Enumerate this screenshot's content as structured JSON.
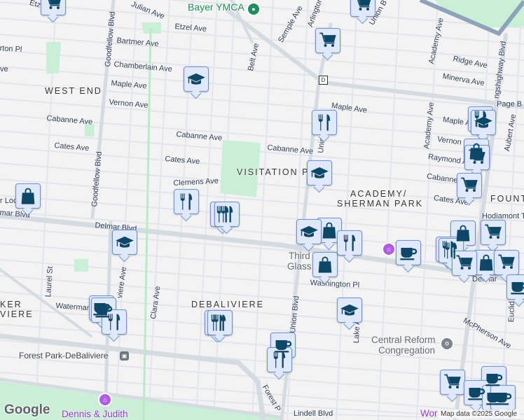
{
  "map": {
    "attribution": "Map data ©2025 Google",
    "logo": "Google",
    "route_badge": "D",
    "neighborhoods": [
      "WEST END",
      "VISITATION P",
      "ACADEMY/",
      "SHERMAN PARK",
      "FOUNT",
      "DEBALIVIERE",
      "KER",
      "VIERE"
    ],
    "streets": [
      "Julian Ave",
      "Etzel Ave",
      "Bartmer Ave",
      "Chamberlain Ave",
      "Maple Ave",
      "Vernon Ave",
      "Cabanne Ave",
      "Cabanne Ave",
      "Cates Ave",
      "Cates Ave",
      "Clemens Ave",
      "Goodfellow Blvd",
      "Goodfellow Blvd",
      "Belt Ave",
      "Semple Ave",
      "Arlington",
      "Union B",
      "Academy Ave",
      "Ridge Ave",
      "Minerva Ave",
      "ngshighway Blvd",
      "Page B",
      "Maple Ave",
      "Maple A",
      "Academy Ave",
      "Vernon",
      "Raymond A",
      "Cabanne",
      "Cates Ave",
      "Aubert Ave",
      "Cabanne Ave",
      "Union",
      "Hodiamont T",
      "mar Blvd",
      "Delmar Blvd",
      "r Loc",
      "Union Blvd",
      "Washington Pl",
      "Lake A",
      "McPherson Ave",
      "Euclid",
      "Delmar",
      "Laurel St",
      "Clara Ave",
      "viere Ave",
      "Waterman",
      "Forest P",
      "Lindell Blvd",
      "rton Pl",
      "ve",
      "Etze"
    ],
    "places": {
      "ymca": "Bayer YMCA",
      "glass1": "Third",
      "glass2": "Glass",
      "church1": "Central Reform",
      "church2": "Congregation",
      "metro": "Forest Park-DeBaliviere",
      "museum": "Dennis & Judith",
      "world": "Wor"
    }
  }
}
